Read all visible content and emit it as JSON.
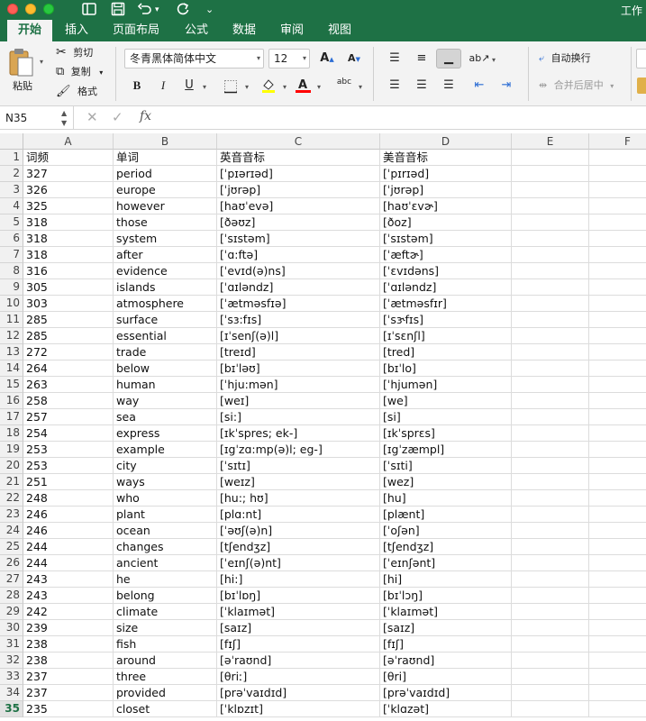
{
  "window": {
    "title": "工作"
  },
  "quick_access": {
    "sidebar_icon": "sidebar-toggle-icon",
    "save_icon": "save-icon",
    "undo_icon": "undo-icon",
    "redo_icon": "redo-icon",
    "more_icon": "chevron-down-icon"
  },
  "ribbon": {
    "tabs": [
      "开始",
      "插入",
      "页面布局",
      "公式",
      "数据",
      "审阅",
      "视图"
    ],
    "active_tab": "开始",
    "clipboard": {
      "paste": "粘贴",
      "cut": "剪切",
      "copy": "复制",
      "format_painter": "格式"
    },
    "font": {
      "name": "冬青黑体简体中文",
      "size": "12",
      "bold": "B",
      "italic": "I",
      "underline": "U",
      "grow": "A",
      "shrink": "A",
      "phonetic": "abc"
    },
    "alignment": {
      "wrap_text": "自动换行",
      "merge_center": "合并后居中"
    }
  },
  "formula_bar": {
    "name_box": "N35",
    "formula": ""
  },
  "grid": {
    "columns": [
      "A",
      "B",
      "C",
      "D",
      "E",
      "F"
    ],
    "active_row": "35",
    "rows": [
      {
        "n": "1",
        "a": "词频",
        "b": "单词",
        "c": "英音音标",
        "d": "美音音标"
      },
      {
        "n": "2",
        "a": "327",
        "b": "period",
        "c": "[ˈpɪərɪəd]",
        "d": "[ˈpɪrɪəd]"
      },
      {
        "n": "3",
        "a": "326",
        "b": "europe",
        "c": "[ˈjʊrəp]",
        "d": "[ˈjʊrəp]"
      },
      {
        "n": "4",
        "a": "325",
        "b": "however",
        "c": "[haʊˈevə]",
        "d": "[haʊˈɛvɚ]"
      },
      {
        "n": "5",
        "a": "318",
        "b": "those",
        "c": "[ðəʊz]",
        "d": "[ðoz]"
      },
      {
        "n": "6",
        "a": "318",
        "b": "system",
        "c": "[ˈsɪstəm]",
        "d": "[ˈsɪstəm]"
      },
      {
        "n": "7",
        "a": "318",
        "b": "after",
        "c": "[ˈɑ:ftə]",
        "d": "[ˈæftɚ]"
      },
      {
        "n": "8",
        "a": "316",
        "b": "evidence",
        "c": "[ˈevɪd(ə)ns]",
        "d": "[ˈɛvɪdəns]"
      },
      {
        "n": "9",
        "a": "305",
        "b": "islands",
        "c": "[ˈɑɪləndz]",
        "d": "[ˈɑɪləndz]"
      },
      {
        "n": "10",
        "a": "303",
        "b": "atmosphere",
        "c": "[ˈætməsfɪə]",
        "d": "[ˈætməsfɪr]"
      },
      {
        "n": "11",
        "a": "285",
        "b": "surface",
        "c": "[ˈsɜ:fɪs]",
        "d": "[ˈsɝfɪs]"
      },
      {
        "n": "12",
        "a": "285",
        "b": "essential",
        "c": "[ɪˈsenʃ(ə)l]",
        "d": "[ɪˈsɛnʃl]"
      },
      {
        "n": "13",
        "a": "272",
        "b": "trade",
        "c": "[treɪd]",
        "d": "[tred]"
      },
      {
        "n": "14",
        "a": "264",
        "b": "below",
        "c": "[bɪˈləʊ]",
        "d": "[bɪˈlo]"
      },
      {
        "n": "15",
        "a": "263",
        "b": "human",
        "c": "[ˈhju:mən]",
        "d": "[ˈhjumən]"
      },
      {
        "n": "16",
        "a": "258",
        "b": "way",
        "c": "[weɪ]",
        "d": "[we]"
      },
      {
        "n": "17",
        "a": "257",
        "b": "sea",
        "c": "[si:]",
        "d": "[si]"
      },
      {
        "n": "18",
        "a": "254",
        "b": "express",
        "c": "[ɪkˈspres; ek-]",
        "d": "[ɪkˈsprɛs]"
      },
      {
        "n": "19",
        "a": "253",
        "b": "example",
        "c": "[ɪgˈzɑ:mp(ə)l; eg-]",
        "d": "[ɪgˈzæmpl]"
      },
      {
        "n": "20",
        "a": "253",
        "b": "city",
        "c": "[ˈsɪtɪ]",
        "d": "[ˈsɪti]"
      },
      {
        "n": "21",
        "a": "251",
        "b": "ways",
        "c": "[weɪz]",
        "d": "[wez]"
      },
      {
        "n": "22",
        "a": "248",
        "b": "who",
        "c": "[hu:; hʊ]",
        "d": "[hu]"
      },
      {
        "n": "23",
        "a": "246",
        "b": "plant",
        "c": "[plɑ:nt]",
        "d": "[plænt]"
      },
      {
        "n": "24",
        "a": "246",
        "b": "ocean",
        "c": "[ˈəʊʃ(ə)n]",
        "d": "[ˈoʃən]"
      },
      {
        "n": "25",
        "a": "244",
        "b": "changes",
        "c": "[tʃendʒz]",
        "d": "[tʃendʒz]"
      },
      {
        "n": "26",
        "a": "244",
        "b": "ancient",
        "c": "[ˈeɪnʃ(ə)nt]",
        "d": "[ˈeɪnʃənt]"
      },
      {
        "n": "27",
        "a": "243",
        "b": "he",
        "c": "[hi:]",
        "d": "[hi]"
      },
      {
        "n": "28",
        "a": "243",
        "b": "belong",
        "c": "[bɪˈlɒŋ]",
        "d": "[bɪˈlɔŋ]"
      },
      {
        "n": "29",
        "a": "242",
        "b": "climate",
        "c": "[ˈklaɪmət]",
        "d": "[ˈklaɪmət]"
      },
      {
        "n": "30",
        "a": "239",
        "b": "size",
        "c": "[saɪz]",
        "d": "[saɪz]"
      },
      {
        "n": "31",
        "a": "238",
        "b": "fish",
        "c": "[fɪʃ]",
        "d": "[fɪʃ]"
      },
      {
        "n": "32",
        "a": "238",
        "b": "around",
        "c": "[əˈraʊnd]",
        "d": "[əˈraʊnd]"
      },
      {
        "n": "33",
        "a": "237",
        "b": "three",
        "c": "[θriː]",
        "d": "[θri]"
      },
      {
        "n": "34",
        "a": "237",
        "b": "provided",
        "c": "[prəˈvaɪdɪd]",
        "d": "[prəˈvaɪdɪd]"
      },
      {
        "n": "35",
        "a": "235",
        "b": "closet",
        "c": "[ˈklɒzɪt]",
        "d": "[ˈklɑzət]"
      }
    ]
  },
  "colors": {
    "accent": "#1e7145",
    "highlight_fill": "#ffff00",
    "font_color": "#ff0000"
  }
}
